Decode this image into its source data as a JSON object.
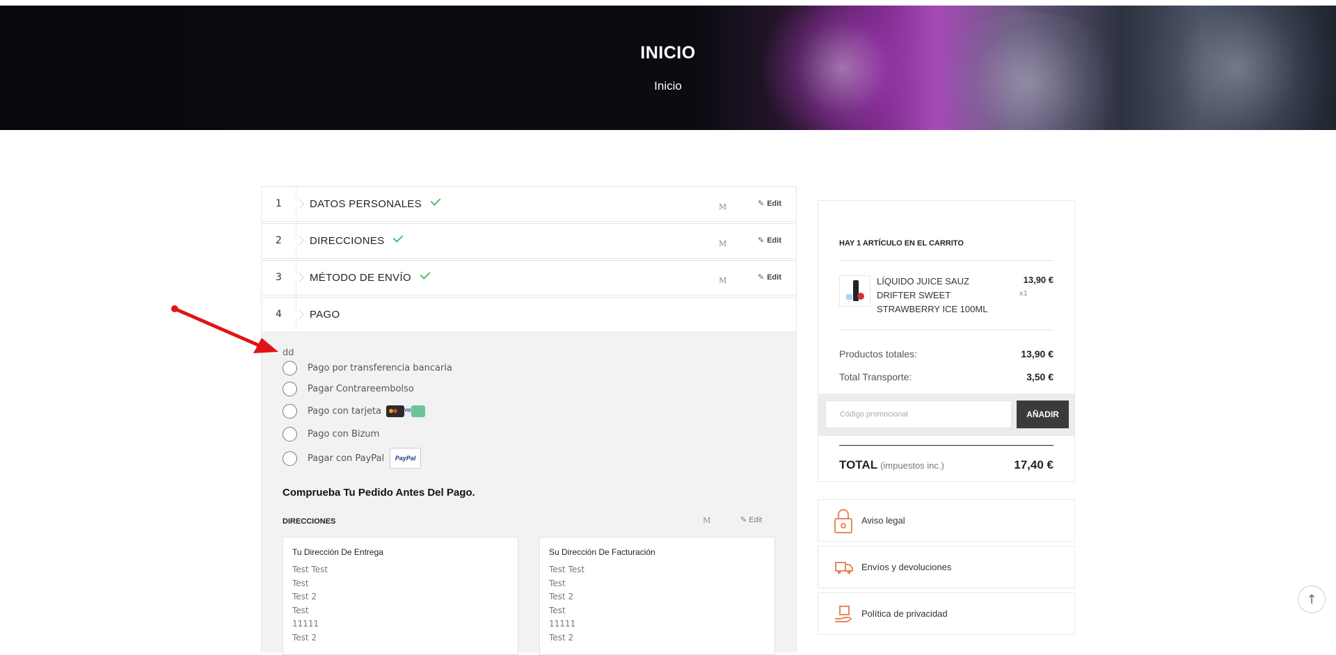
{
  "hero": {
    "title": "INICIO",
    "breadcrumb": "Inicio"
  },
  "steps": [
    {
      "num": "1",
      "title": "DATOS PERSONALES",
      "done": true,
      "m": "M",
      "edit": "Edit"
    },
    {
      "num": "2",
      "title": "DIRECCIONES",
      "done": true,
      "m": "M",
      "edit": "Edit"
    },
    {
      "num": "3",
      "title": "MÉTODO DE ENVÍO",
      "done": true,
      "m": "M",
      "edit": "Edit"
    },
    {
      "num": "4",
      "title": "PAGO",
      "done": false
    }
  ],
  "payment": {
    "note": "dd",
    "options": [
      "Pago por transferencia bancaria",
      "Pagar Contrareembolso",
      "Pago con tarjeta",
      "Pago con Bizum",
      "Pagar con PayPal"
    ],
    "paypal_logo": "PayPal",
    "card_logo": "VISA",
    "review_title": "Comprueba Tu Pedido Antes Del Pago.",
    "addresses_heading": "DIRECCIONES",
    "addresses_m": "M",
    "addresses_edit": "Edit",
    "delivery": {
      "title": "Tu Dirección De Entrega",
      "lines": [
        "Test Test",
        "Test",
        "Test 2",
        "Test",
        "11111",
        "Test 2"
      ]
    },
    "billing": {
      "title": "Su Dirección De Facturación",
      "lines": [
        "Test Test",
        "Test",
        "Test 2",
        "Test",
        "11111",
        "Test 2"
      ]
    }
  },
  "cart": {
    "count_label": "HAY 1 ARTÍCULO EN EL CARRITO",
    "product": {
      "name": "LÍQUIDO JUICE SAUZ DRIFTER SWEET STRAWBERRY ICE 100ML",
      "price": "13,90 €",
      "qty": "x1"
    },
    "subtotal_label": "Productos totales:",
    "subtotal": "13,90 €",
    "shipping_label": "Total Transporte:",
    "shipping": "3,50 €",
    "promo_placeholder": "Código promocional",
    "promo_button": "AÑADIR",
    "total_label": "TOTAL",
    "total_tax": "(impuestos inc.)",
    "total": "17,40 €"
  },
  "info": [
    {
      "icon": "lock-icon",
      "label": "Aviso legal"
    },
    {
      "icon": "truck-icon",
      "label": "Envíos y devoluciones"
    },
    {
      "icon": "hand-box-icon",
      "label": "Política de privacidad"
    }
  ],
  "colors": {
    "accent_check": "#4cbb6c",
    "button_dark": "#3b3b3b",
    "info_icon": "#e8875a",
    "annotation_arrow": "#e01414"
  }
}
